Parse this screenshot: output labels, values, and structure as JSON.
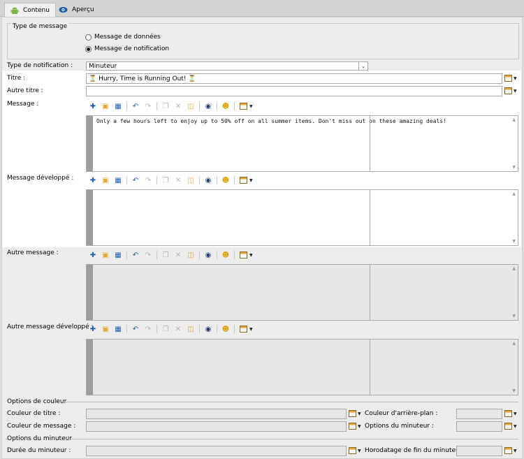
{
  "tabs": [
    {
      "label": "Contenu"
    },
    {
      "label": "Aperçu"
    }
  ],
  "message_type": {
    "legend": "Type de message",
    "options": [
      {
        "label": "Message de données",
        "selected": false
      },
      {
        "label": "Message de notification",
        "selected": true
      }
    ]
  },
  "notification_type": {
    "label": "Type de notification :",
    "value": "Minuteur"
  },
  "title": {
    "label": "Titre :",
    "value": "⏳ Hurry, Time is Running Out! ⏳"
  },
  "alt_title": {
    "label": "Autre titre :",
    "value": ""
  },
  "message": {
    "label": "Message :",
    "value": "Only a few hours left to enjoy up to 50% off on all summer items. Don't miss out on these amazing deals!"
  },
  "expanded_message": {
    "label": "Message développé :",
    "value": ""
  },
  "alt_message": {
    "label": "Autre message :",
    "value": ""
  },
  "alt_expanded_message": {
    "label": "Autre message développé :",
    "value": ""
  },
  "color_options": {
    "heading": "Options de couleur",
    "title_color": {
      "label": "Couleur de titre :",
      "value": ""
    },
    "bg_color": {
      "label": "Couleur d'arrière-plan :",
      "value": ""
    },
    "message_color": {
      "label": "Couleur de message :",
      "value": ""
    },
    "timer_options_field": {
      "label": "Options du minuteur :",
      "value": ""
    }
  },
  "timer_options": {
    "heading": "Options du minuteur",
    "duration": {
      "label": "Durée du minuteur :",
      "value": ""
    },
    "end_timestamp": {
      "label": "Horodatage de fin du minuteur :",
      "value": ""
    }
  },
  "colors": {
    "accent": "#1565c0",
    "folder": "#e3a52a",
    "highlight_bg": "#ffffff",
    "panel_bg": "#ececec"
  }
}
